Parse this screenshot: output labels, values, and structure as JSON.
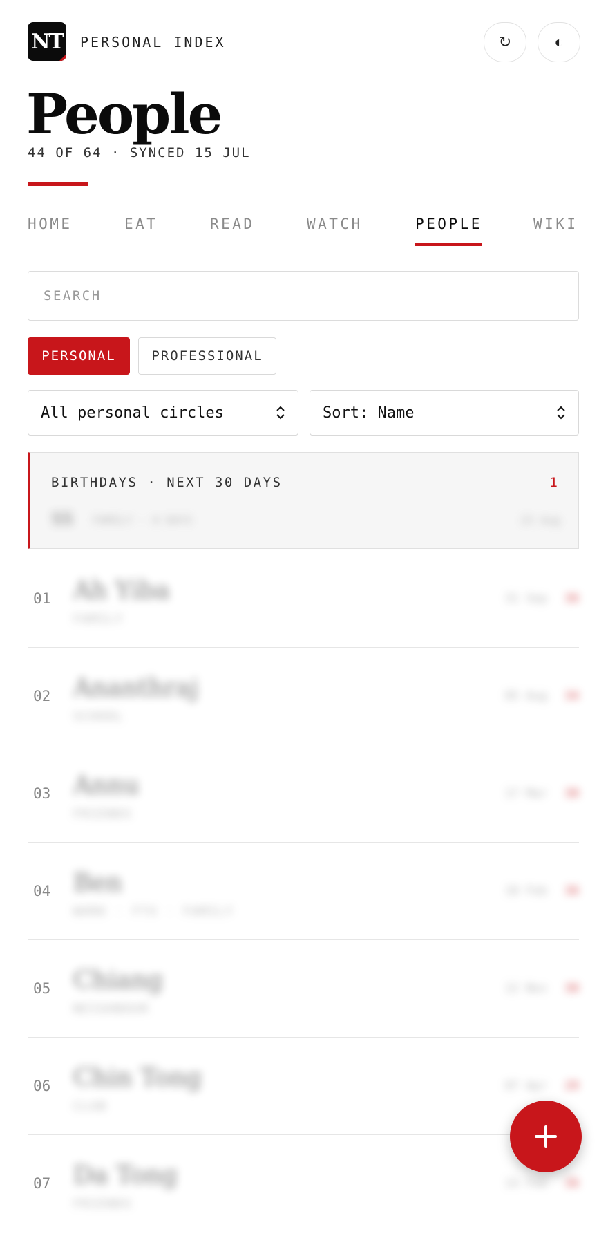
{
  "header": {
    "logo_text": "NT",
    "brand_label": "PERSONAL INDEX",
    "refresh_icon": "↻",
    "theme_icon": "◐",
    "title": "People",
    "subtitle": "44 OF 64 · SYNCED 15 JUL"
  },
  "tabs": [
    {
      "label": "HOME"
    },
    {
      "label": "EAT"
    },
    {
      "label": "READ"
    },
    {
      "label": "WATCH"
    },
    {
      "label": "PEOPLE",
      "active": true
    },
    {
      "label": "WIKI"
    }
  ],
  "search": {
    "placeholder": "SEARCH",
    "value": ""
  },
  "segments": {
    "personal": "PERSONAL",
    "professional": "PROFESSIONAL",
    "selected": "personal"
  },
  "filters": {
    "circles": "All personal circles",
    "sort": "Sort: Name"
  },
  "birthdays": {
    "title": "BIRTHDAYS · NEXT 30 DAYS",
    "count": "1",
    "entry": {
      "name": "SS",
      "meta": "FAMILY · 8 DAYS",
      "date": "23 Aug"
    }
  },
  "people": [
    {
      "num": "01",
      "name": "Ah Yiba",
      "circle": "FAMILY",
      "date": "31 Sep",
      "badge": "36"
    },
    {
      "num": "02",
      "name": "Ananthraj",
      "circle": "SCHOOL",
      "date": "05 Aug",
      "badge": "34"
    },
    {
      "num": "03",
      "name": "Annu",
      "circle": "FRIENDS",
      "date": "17 Mar",
      "badge": "30"
    },
    {
      "num": "04",
      "name": "Ben",
      "circle": "WORK · FTX · FAMILY",
      "date": "10 Feb",
      "badge": "36"
    },
    {
      "num": "05",
      "name": "Chiang",
      "circle": "NEIGHBOUR",
      "date": "12 Nov",
      "badge": "30"
    },
    {
      "num": "06",
      "name": "Chin Tong",
      "circle": "CLUB",
      "date": "07 Apr",
      "badge": "29"
    },
    {
      "num": "07",
      "name": "Da Tong",
      "circle": "FRIENDS",
      "date": "14 Feb",
      "badge": "36"
    }
  ],
  "fab": {
    "icon": "plus-icon"
  },
  "colors": {
    "accent": "#c8161b",
    "text": "#111111",
    "muted": "#8a8a8a",
    "border": "#e2e2e2",
    "panel": "#f6f6f6"
  }
}
